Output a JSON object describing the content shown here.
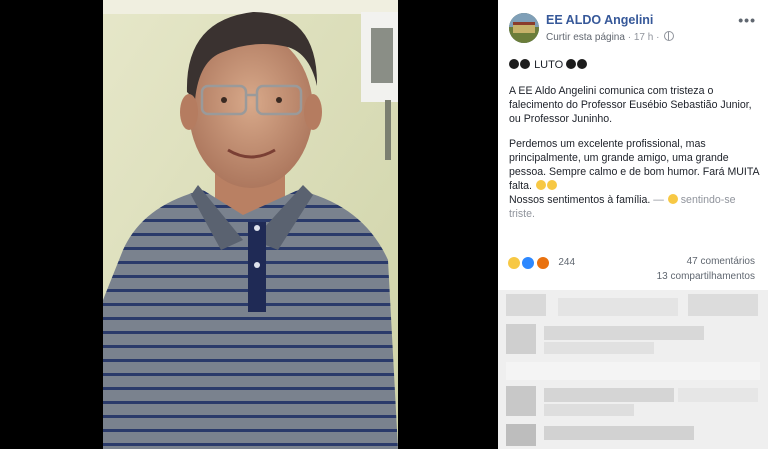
{
  "post": {
    "page_name": "EE ALDO Angelini",
    "like_page_label": "Curtir esta página",
    "separator": "·",
    "time": "17 h",
    "separator2": "·",
    "luto_label": "LUTO",
    "paragraph1": "A EE Aldo Angelini comunica com tristeza o falecimento do Professor Eusébio Sebastião Junior, ou Professor Juninho.",
    "paragraph2_line1": "Perdemos um excelente profissional, mas principalmente, um grande amigo, uma grande pessoa. Sempre calmo e de bom humor. Fará MUITA falta.",
    "paragraph2_line2": "Nossos sentimentos à família.",
    "feeling_separator": " — ",
    "feeling_text": "sentindo-se triste.",
    "more_icon": "•••"
  },
  "stats": {
    "reaction_count": "244",
    "comments": "47 comentários",
    "shares": "13 compartilhamentos"
  },
  "icons": {
    "globe": "globe-icon",
    "more": "more-options-icon",
    "sad": "sad-reaction-icon",
    "like": "like-reaction-icon",
    "angry": "angry-reaction-icon"
  },
  "colors": {
    "link": "#365899",
    "meta": "#90949c",
    "text": "#1d2129"
  }
}
